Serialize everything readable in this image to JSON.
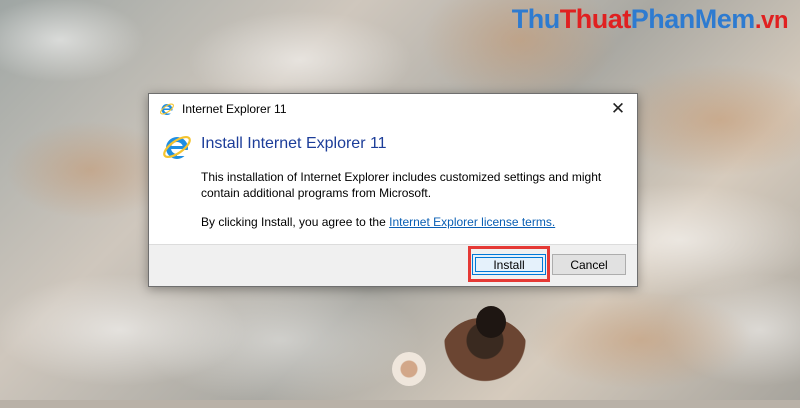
{
  "watermark": {
    "part1": "Thu",
    "part2": "Thuat",
    "part3": "PhanMem",
    "part4": ".vn"
  },
  "dialog": {
    "window_title": "Internet Explorer 11",
    "close_glyph": "✕",
    "heading": "Install Internet Explorer 11",
    "description": "This installation of Internet Explorer includes customized settings and might contain additional programs from Microsoft.",
    "agreement_prefix": "By clicking Install, you agree to the ",
    "agreement_link": "Internet Explorer license terms.",
    "install_label": "Install",
    "cancel_label": "Cancel",
    "icon": "internet-explorer-icon"
  },
  "colors": {
    "heading": "#1c3d99",
    "link": "#0a5fb4",
    "highlight": "#e53935",
    "ie_blue": "#1e8ee3",
    "ie_ring": "#f4c430"
  }
}
